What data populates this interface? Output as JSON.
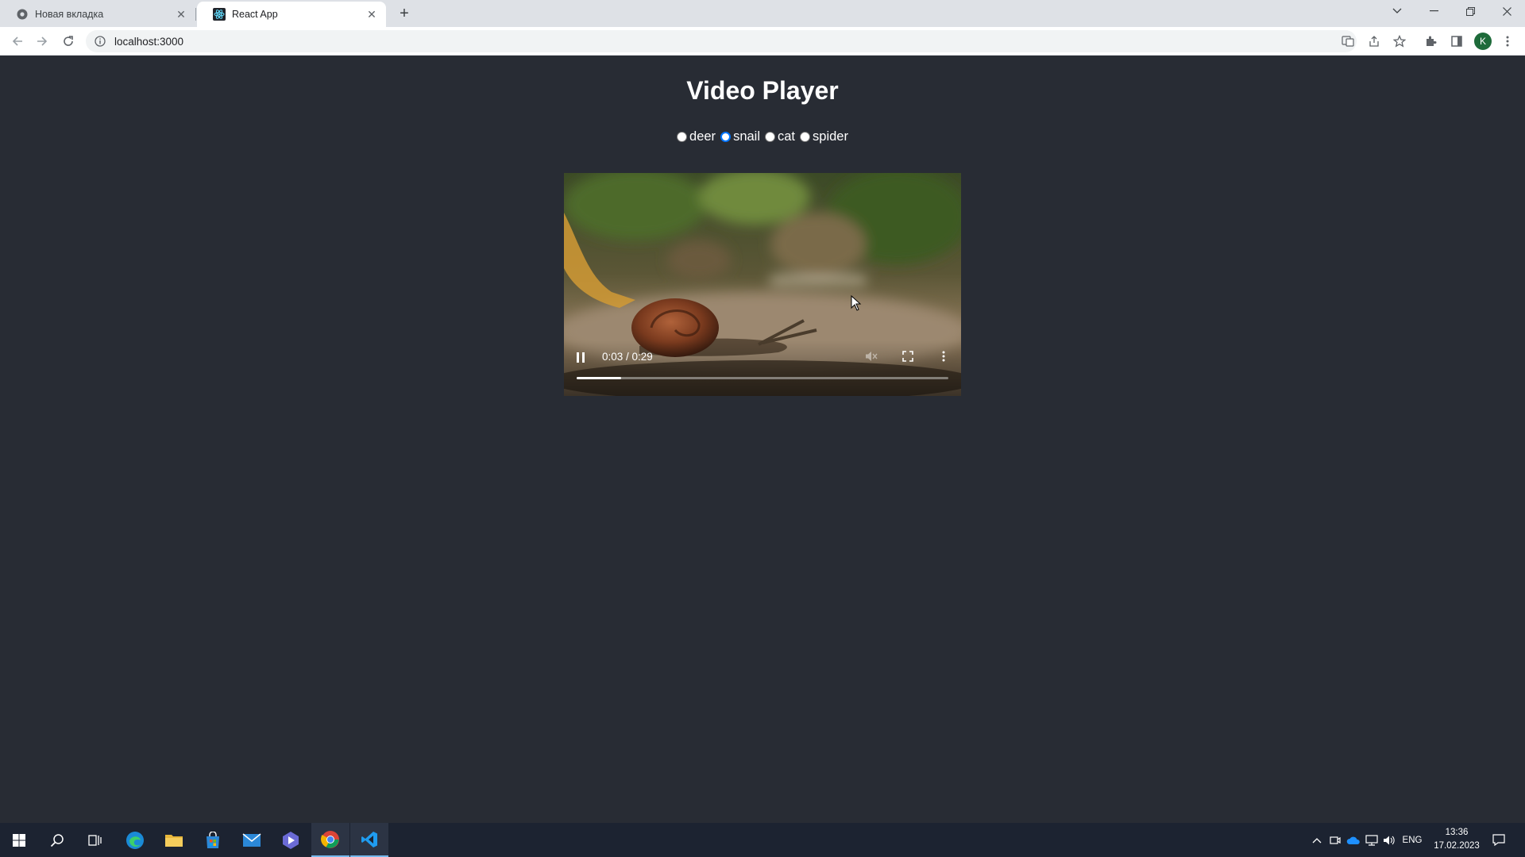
{
  "browser": {
    "tabs": [
      {
        "title": "Новая вкладка",
        "active": false
      },
      {
        "title": "React App",
        "active": true
      }
    ],
    "url": "localhost:3000",
    "profile_initial": "K"
  },
  "page": {
    "title": "Video Player",
    "options": [
      {
        "label": "deer",
        "checked": false
      },
      {
        "label": "snail",
        "checked": true
      },
      {
        "label": "cat",
        "checked": false
      },
      {
        "label": "spider",
        "checked": false
      }
    ]
  },
  "video": {
    "time": "0:03 / 0:29",
    "progress_fraction": 0.12,
    "muted": true
  },
  "taskbar": {
    "language": "ENG",
    "time": "13:36",
    "date": "17.02.2023"
  },
  "colors": {
    "page_bg": "#282c34",
    "radio_checked": "#0075ff",
    "taskbar_bg": "#1c2331"
  }
}
